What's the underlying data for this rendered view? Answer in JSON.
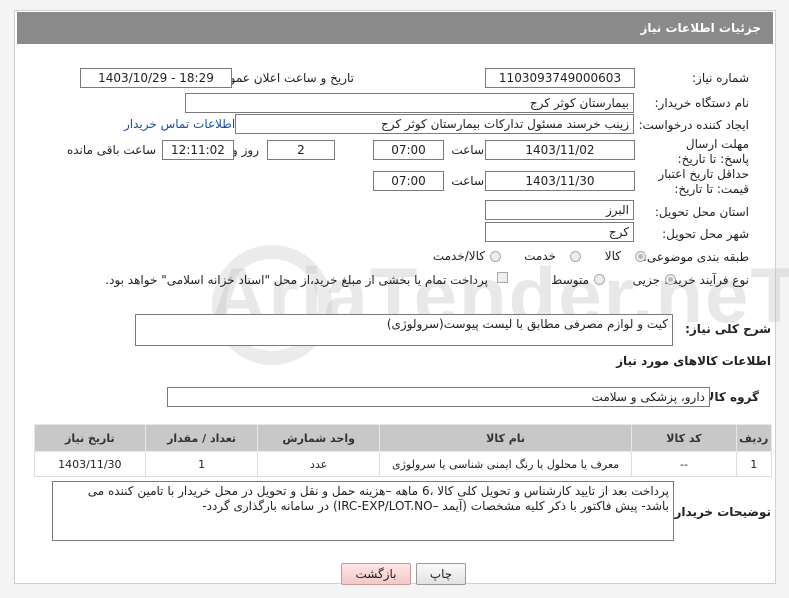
{
  "header": {
    "title": "جزئیات اطلاعات نیاز"
  },
  "fields": {
    "need_number_label": "شماره نیاز:",
    "need_number": "1103093749000603",
    "announce_label": "تاریخ و ساعت اعلان عمومی:",
    "announce_value": "1403/10/29 - 18:29",
    "buyer_org_label": "نام دستگاه خریدار:",
    "buyer_org": "بیمارستان کوثر کرج",
    "creator_label": "ایجاد کننده درخواست:",
    "creator": "زینب خرسند مسئول تدارکات بیمارستان کوثر کرج",
    "buyer_contact_link": "اطلاعات تماس خریدار",
    "deadline_label": "مهلت ارسال پاسخ: تا تاریخ:",
    "deadline_date": "1403/11/02",
    "time_label": "ساعت",
    "deadline_time": "07:00",
    "days_value": "2",
    "days_label": "روز و",
    "remaining_time": "12:11:02",
    "remaining_label": "ساعت باقی مانده",
    "validity_label": "حداقل تاریخ اعتبار قیمت: تا تاریخ:",
    "validity_date": "1403/11/30",
    "validity_time": "07:00",
    "province_label": "استان محل تحویل:",
    "province": "البرز",
    "city_label": "شهر محل تحویل:",
    "city": "کرج",
    "category_label": "طبقه بندی موضوعی:",
    "category_options": [
      "کالا",
      "خدمت",
      "کالا/خدمت"
    ],
    "process_label": "نوع فرآیند خرید :",
    "process_options": [
      "جزیی",
      "متوسط"
    ],
    "payment_note": "پرداخت تمام یا بخشی از مبلغ خرید،از محل \"اسناد خزانه اسلامی\" خواهد بود."
  },
  "summary": {
    "label": "شرح کلی نیاز:",
    "value": "کیت و لوازم مصرفی مطابق با لیست پیوست(سرولوژی)"
  },
  "goods_info_title": "اطلاعات کالاهای مورد نیاز",
  "goods_group": {
    "label": "گروه کالا:",
    "value": "دارو، پزشکی و سلامت"
  },
  "table": {
    "headers": [
      "ردیف",
      "کد کالا",
      "نام کالا",
      "واحد شمارش",
      "تعداد / مقدار",
      "تاریخ نیاز"
    ],
    "rows": [
      [
        "1",
        "--",
        "معرف یا محلول یا رنگ ایمنی شناسی یا سرولوژی",
        "عدد",
        "1",
        "1403/11/30"
      ]
    ]
  },
  "buyer_notes": {
    "label": "توضیحات خریدار:",
    "value": "پرداخت بعد از تایید کارشناس و تحویل کلی کالا ،6 ماهه –هزینه حمل و نقل و تحویل در محل خریدار با تامین کننده می باشد- پیش فاکتور با ذکر کلیه مشخصات (آیمد –IRC-EXP/LOT.NO) در سامانه بارگذاری گردد-"
  },
  "buttons": {
    "print": "چاپ",
    "back": "بازگشت"
  },
  "watermark": "AriaTender.neT",
  "colors": {
    "header_bg": "#8a8a8a",
    "link": "#1a4f9c",
    "table_header": "#c8c8c8"
  }
}
